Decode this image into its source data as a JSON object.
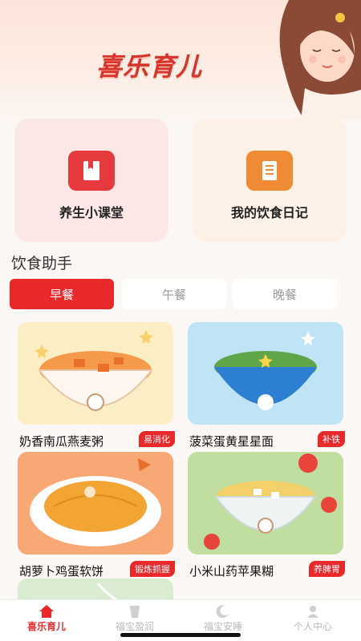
{
  "header": {
    "title": "喜乐育儿"
  },
  "cards": [
    {
      "label": "养生小课堂",
      "icon": "book-icon",
      "color": "#e63a3f"
    },
    {
      "label": "我的饮食日记",
      "icon": "notepad-icon",
      "color": "#f08a35"
    }
  ],
  "section": {
    "title": "饮食助手"
  },
  "tabs": [
    {
      "label": "早餐",
      "active": true
    },
    {
      "label": "午餐",
      "active": false
    },
    {
      "label": "晚餐",
      "active": false
    }
  ],
  "foods": [
    {
      "name": "奶香南瓜燕麦粥",
      "tag": "易消化"
    },
    {
      "name": "菠菜蛋黄星星面",
      "tag": "补铁"
    },
    {
      "name": "胡萝卜鸡蛋软饼",
      "tag": "锻炼抓握"
    },
    {
      "name": "小米山药苹果糊",
      "tag": "养脾胃"
    }
  ],
  "nav": [
    {
      "label": "喜乐育儿",
      "icon": "home-icon",
      "active": true
    },
    {
      "label": "福宝盈润",
      "icon": "cup-icon",
      "active": false
    },
    {
      "label": "福宝安睡",
      "icon": "moon-icon",
      "active": false
    },
    {
      "label": "个人中心",
      "icon": "person-icon",
      "active": false
    }
  ],
  "colors": {
    "accent": "#e8282b",
    "orange": "#f08a35"
  }
}
